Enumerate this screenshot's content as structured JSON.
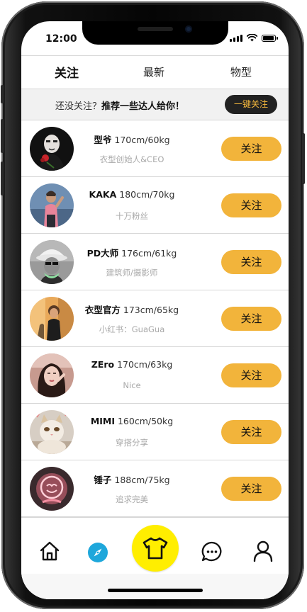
{
  "status": {
    "time": "12:00"
  },
  "tabs": [
    {
      "label": "关注"
    },
    {
      "label": "最新"
    },
    {
      "label": "物型"
    }
  ],
  "banner": {
    "prefix": "还没关注？",
    "highlight": "推荐一些达人给你！",
    "button": "一键关注"
  },
  "users": [
    {
      "name": "型爷",
      "stats": "170cm/60kg",
      "desc": "衣型创始人&CEO",
      "follow": "关注"
    },
    {
      "name": "KAKA",
      "stats": "180cm/70kg",
      "desc": "十万粉丝",
      "follow": "关注"
    },
    {
      "name": "PD大师",
      "stats": "176cm/61kg",
      "desc": "建筑师/摄影师",
      "follow": "关注"
    },
    {
      "name": "衣型官方",
      "stats": "173cm/65kg",
      "desc": "小红书：GuaGua",
      "follow": "关注"
    },
    {
      "name": "ZEro",
      "stats": "170cm/63kg",
      "desc": "Nice",
      "follow": "关注"
    },
    {
      "name": "MIMI",
      "stats": "160cm/50kg",
      "desc": "穿搭分享",
      "follow": "关注"
    },
    {
      "name": "锤子",
      "stats": "188cm/75kg",
      "desc": "追求完美",
      "follow": "关注"
    }
  ],
  "nav": [
    {
      "icon": "home-icon"
    },
    {
      "icon": "compass-icon"
    },
    {
      "icon": "tshirt-icon"
    },
    {
      "icon": "chat-icon"
    },
    {
      "icon": "user-icon"
    }
  ],
  "colors": {
    "accent": "#f2b43b",
    "center_button": "#ffee00",
    "compass": "#1ea7db",
    "banner_button": "#222222",
    "banner_button_text": "#f5b83d"
  }
}
